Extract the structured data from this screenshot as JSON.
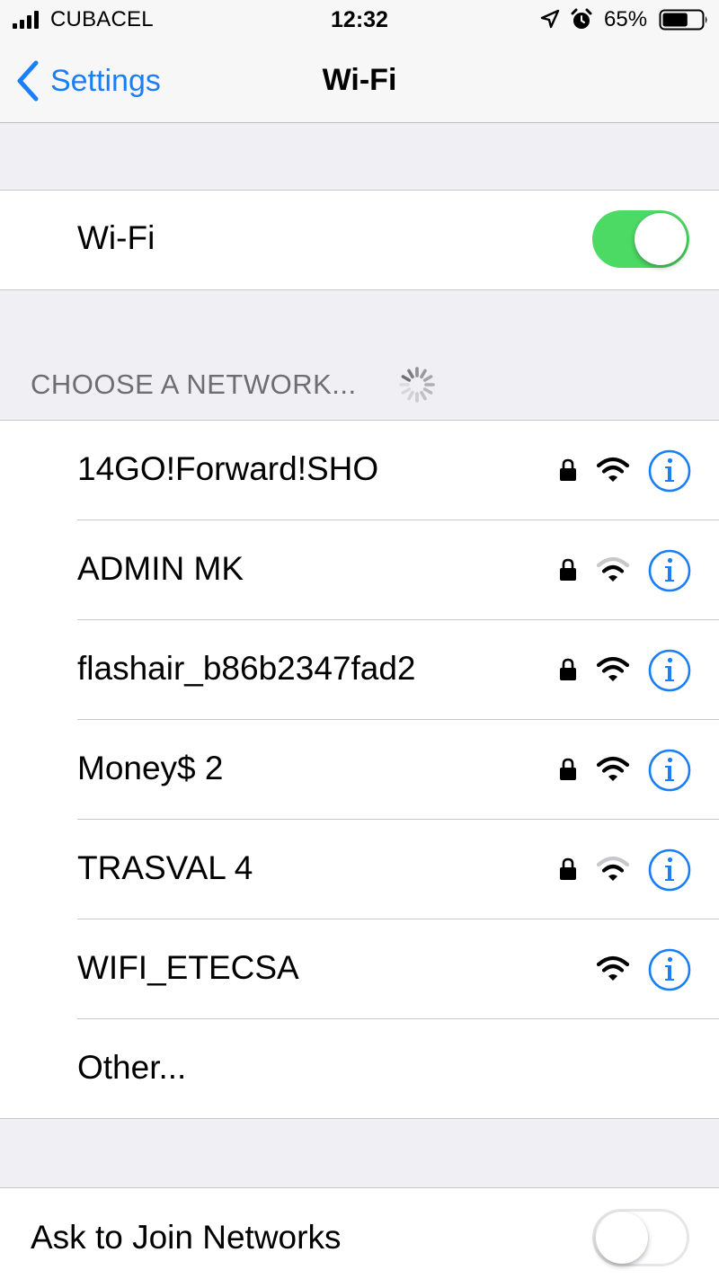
{
  "status_bar": {
    "carrier": "CUBACEL",
    "time": "12:32",
    "battery_percent": "65%",
    "battery_level": 0.65,
    "icons": [
      "signal-icon",
      "location-arrow-icon",
      "alarm-icon",
      "battery-icon"
    ]
  },
  "nav": {
    "back_label": "Settings",
    "title": "Wi-Fi"
  },
  "wifi_toggle": {
    "label": "Wi-Fi",
    "on": true
  },
  "section": {
    "header": "CHOOSE A NETWORK..."
  },
  "networks": [
    {
      "name": "14GO!Forward!SHO",
      "secured": true,
      "signal": "full"
    },
    {
      "name": "ADMIN MK",
      "secured": true,
      "signal": "weak"
    },
    {
      "name": "flashair_b86b2347fad2",
      "secured": true,
      "signal": "full"
    },
    {
      "name": "Money$ 2",
      "secured": true,
      "signal": "full"
    },
    {
      "name": "TRASVAL 4",
      "secured": true,
      "signal": "weak"
    },
    {
      "name": "WIFI_ETECSA",
      "secured": false,
      "signal": "full"
    }
  ],
  "other": {
    "label": "Other..."
  },
  "ask_to_join": {
    "label": "Ask to Join Networks",
    "on": false
  },
  "colors": {
    "accent": "#1a7ef6",
    "toggle_on": "#4cd964",
    "background": "#efeff4",
    "weak_signal": "#c7c7cc"
  }
}
